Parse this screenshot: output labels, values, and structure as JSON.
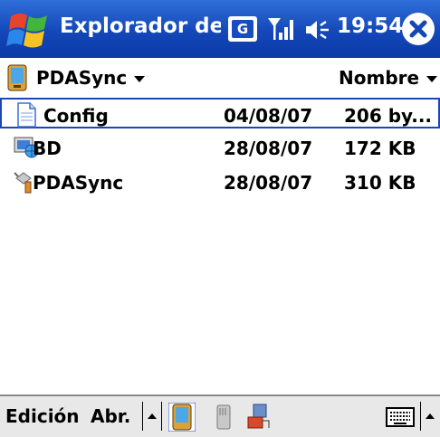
{
  "titlebar": {
    "title": "Explorador de a",
    "network_badge": "G",
    "time": "19:54",
    "icons": [
      "windows-start-icon",
      "signal-icon",
      "volume-icon",
      "close-icon"
    ]
  },
  "header": {
    "folder": "PDASync",
    "sort": "Nombre"
  },
  "files": [
    {
      "name": "Config",
      "date": "04/08/07",
      "size": "206 by...",
      "icon": "text-file-icon"
    },
    {
      "name": "BD",
      "date": "28/08/07",
      "size": "172 KB",
      "icon": "database-file-icon"
    },
    {
      "name": "PDASync",
      "date": "28/08/07",
      "size": "310 KB",
      "icon": "program-file-icon"
    }
  ],
  "toolbar": {
    "edit_label": "Edición",
    "open_label": "Abr.",
    "icons": [
      "scroll-up-icon",
      "device-icon",
      "storage-card-icon",
      "network-share-icon",
      "keyboard-icon",
      "input-menu-arrow-icon"
    ]
  },
  "colors": {
    "titlebar": "#1447b8",
    "selection": "#1a47b8",
    "toolbar": "#e8e8e8"
  }
}
